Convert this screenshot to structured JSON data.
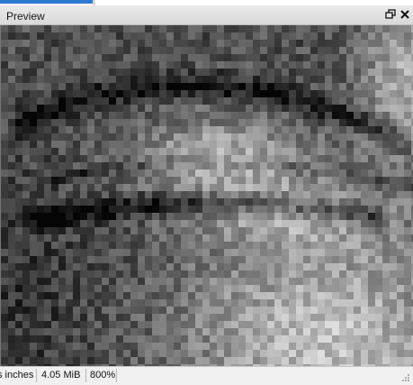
{
  "panel": {
    "title": "Preview",
    "restore_icon": "restore-window-icon",
    "close_icon": "close-icon"
  },
  "preview": {
    "content": "zoomed grayscale pixel image of an eye"
  },
  "status": {
    "size_inches": "s inches",
    "file_size": "4.05 MiB",
    "zoom": "800%"
  },
  "colors": {
    "titlebar": "#e0e0e0",
    "status_bg": "#f0f0f0",
    "accent": "#2f7ad3"
  }
}
